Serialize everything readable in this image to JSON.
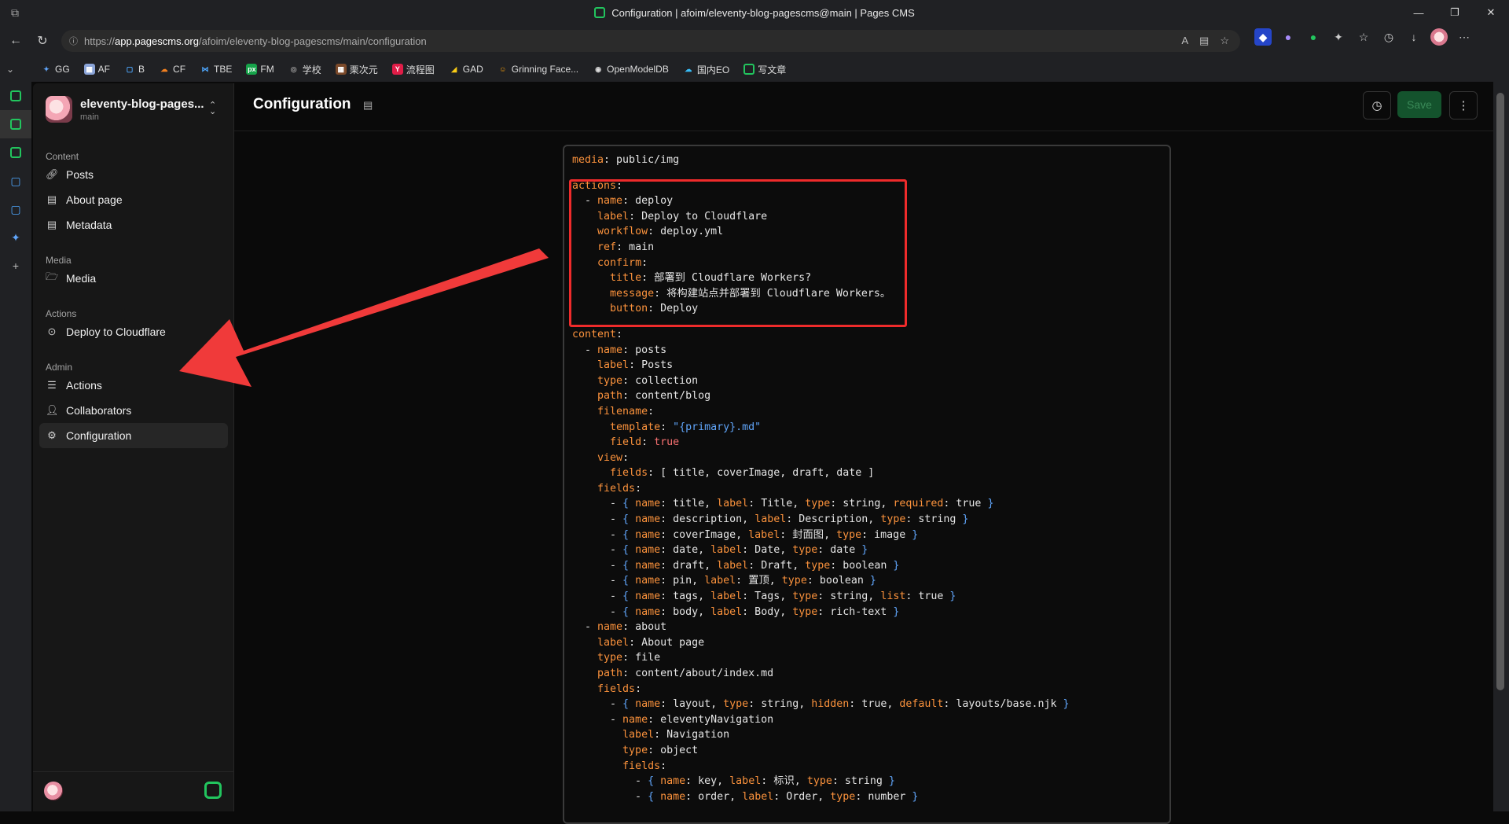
{
  "browser": {
    "window_title": "Configuration | afoim/eleventy-blog-pagescms@main | Pages CMS",
    "url_scheme": "https://",
    "url_host": "app.pagescms.org",
    "url_path": "/afoim/eleventy-blog-pagescms/main/configuration",
    "bookmarks": [
      "GG",
      "AF",
      "B",
      "CF",
      "TBE",
      "FM",
      "学校",
      "栗次元",
      "流程图",
      "GAD",
      "Grinning Face...",
      "OpenModelDB",
      "国内EO",
      "写文章"
    ]
  },
  "sidebar": {
    "repo_name": "eleventy-blog-pages...",
    "branch": "main",
    "sections": {
      "content": "Content",
      "media": "Media",
      "actions": "Actions",
      "admin": "Admin"
    },
    "items": {
      "posts": "Posts",
      "about": "About page",
      "metadata": "Metadata",
      "media": "Media",
      "deploy": "Deploy to Cloudflare",
      "actions": "Actions",
      "collaborators": "Collaborators",
      "configuration": "Configuration"
    }
  },
  "header": {
    "title": "Configuration",
    "save_label": "Save"
  },
  "editor": {
    "lines": [
      [
        [
          "k",
          "media"
        ],
        [
          "s",
          ": public/img"
        ]
      ],
      [
        [
          "k",
          "actions"
        ],
        [
          "s",
          ":"
        ]
      ],
      [
        [
          "s",
          "  - "
        ],
        [
          "k",
          "name"
        ],
        [
          "s",
          ": deploy"
        ]
      ],
      [
        [
          "s",
          "    "
        ],
        [
          "k",
          "label"
        ],
        [
          "s",
          ": Deploy to Cloudflare"
        ]
      ],
      [
        [
          "s",
          "    "
        ],
        [
          "k",
          "workflow"
        ],
        [
          "s",
          ": deploy.yml"
        ]
      ],
      [
        [
          "s",
          "    "
        ],
        [
          "k",
          "ref"
        ],
        [
          "s",
          ": main"
        ]
      ],
      [
        [
          "s",
          "    "
        ],
        [
          "k",
          "confirm"
        ],
        [
          "s",
          ":"
        ]
      ],
      [
        [
          "s",
          "      "
        ],
        [
          "k",
          "title"
        ],
        [
          "s",
          ": 部署到 Cloudflare Workers?"
        ]
      ],
      [
        [
          "s",
          "      "
        ],
        [
          "k",
          "message"
        ],
        [
          "s",
          ": 将构建站点并部署到 Cloudflare Workers。"
        ]
      ],
      [
        [
          "s",
          "      "
        ],
        [
          "k",
          "button"
        ],
        [
          "s",
          ": Deploy"
        ]
      ],
      [
        [
          "k",
          "content"
        ],
        [
          "s",
          ":"
        ]
      ],
      [
        [
          "s",
          "  - "
        ],
        [
          "k",
          "name"
        ],
        [
          "s",
          ": posts"
        ]
      ],
      [
        [
          "s",
          "    "
        ],
        [
          "k",
          "label"
        ],
        [
          "s",
          ": Posts"
        ]
      ],
      [
        [
          "s",
          "    "
        ],
        [
          "k",
          "type"
        ],
        [
          "s",
          ": collection"
        ]
      ],
      [
        [
          "s",
          "    "
        ],
        [
          "k",
          "path"
        ],
        [
          "s",
          ": content/blog"
        ]
      ],
      [
        [
          "s",
          "    "
        ],
        [
          "k",
          "filename"
        ],
        [
          "s",
          ":"
        ]
      ],
      [
        [
          "s",
          "      "
        ],
        [
          "k",
          "template"
        ],
        [
          "s",
          ": "
        ],
        [
          "b",
          "\"{primary}.md\""
        ]
      ],
      [
        [
          "s",
          "      "
        ],
        [
          "k",
          "field"
        ],
        [
          "s",
          ": "
        ],
        [
          "t",
          "true"
        ]
      ],
      [
        [
          "s",
          "    "
        ],
        [
          "k",
          "view"
        ],
        [
          "s",
          ":"
        ]
      ],
      [
        [
          "s",
          "      "
        ],
        [
          "k",
          "fields"
        ],
        [
          "s",
          ": [ title, coverImage, draft, date ]"
        ]
      ],
      [
        [
          "s",
          "    "
        ],
        [
          "k",
          "fields"
        ],
        [
          "s",
          ":"
        ]
      ],
      [
        [
          "s",
          "      - "
        ],
        [
          "b",
          "{ "
        ],
        [
          "k",
          "name"
        ],
        [
          "s",
          ": title, "
        ],
        [
          "k",
          "label"
        ],
        [
          "s",
          ": Title, "
        ],
        [
          "k",
          "type"
        ],
        [
          "s",
          ": string, "
        ],
        [
          "k",
          "required"
        ],
        [
          "s",
          ": true "
        ],
        [
          "b",
          "}"
        ]
      ],
      [
        [
          "s",
          "      - "
        ],
        [
          "b",
          "{ "
        ],
        [
          "k",
          "name"
        ],
        [
          "s",
          ": description, "
        ],
        [
          "k",
          "label"
        ],
        [
          "s",
          ": Description, "
        ],
        [
          "k",
          "type"
        ],
        [
          "s",
          ": string "
        ],
        [
          "b",
          "}"
        ]
      ],
      [
        [
          "s",
          "      - "
        ],
        [
          "b",
          "{ "
        ],
        [
          "k",
          "name"
        ],
        [
          "s",
          ": coverImage, "
        ],
        [
          "k",
          "label"
        ],
        [
          "s",
          ": 封面图, "
        ],
        [
          "k",
          "type"
        ],
        [
          "s",
          ": image "
        ],
        [
          "b",
          "}"
        ]
      ],
      [
        [
          "s",
          "      - "
        ],
        [
          "b",
          "{ "
        ],
        [
          "k",
          "name"
        ],
        [
          "s",
          ": date, "
        ],
        [
          "k",
          "label"
        ],
        [
          "s",
          ": Date, "
        ],
        [
          "k",
          "type"
        ],
        [
          "s",
          ": date "
        ],
        [
          "b",
          "}"
        ]
      ],
      [
        [
          "s",
          "      - "
        ],
        [
          "b",
          "{ "
        ],
        [
          "k",
          "name"
        ],
        [
          "s",
          ": draft, "
        ],
        [
          "k",
          "label"
        ],
        [
          "s",
          ": Draft, "
        ],
        [
          "k",
          "type"
        ],
        [
          "s",
          ": boolean "
        ],
        [
          "b",
          "}"
        ]
      ],
      [
        [
          "s",
          "      - "
        ],
        [
          "b",
          "{ "
        ],
        [
          "k",
          "name"
        ],
        [
          "s",
          ": pin, "
        ],
        [
          "k",
          "label"
        ],
        [
          "s",
          ": 置顶, "
        ],
        [
          "k",
          "type"
        ],
        [
          "s",
          ": boolean "
        ],
        [
          "b",
          "}"
        ]
      ],
      [
        [
          "s",
          "      - "
        ],
        [
          "b",
          "{ "
        ],
        [
          "k",
          "name"
        ],
        [
          "s",
          ": tags, "
        ],
        [
          "k",
          "label"
        ],
        [
          "s",
          ": Tags, "
        ],
        [
          "k",
          "type"
        ],
        [
          "s",
          ": string, "
        ],
        [
          "k",
          "list"
        ],
        [
          "s",
          ": true "
        ],
        [
          "b",
          "}"
        ]
      ],
      [
        [
          "s",
          "      - "
        ],
        [
          "b",
          "{ "
        ],
        [
          "k",
          "name"
        ],
        [
          "s",
          ": body, "
        ],
        [
          "k",
          "label"
        ],
        [
          "s",
          ": Body, "
        ],
        [
          "k",
          "type"
        ],
        [
          "s",
          ": rich-text "
        ],
        [
          "b",
          "}"
        ]
      ],
      [
        [
          "s",
          "  - "
        ],
        [
          "k",
          "name"
        ],
        [
          "s",
          ": about"
        ]
      ],
      [
        [
          "s",
          "    "
        ],
        [
          "k",
          "label"
        ],
        [
          "s",
          ": About page"
        ]
      ],
      [
        [
          "s",
          "    "
        ],
        [
          "k",
          "type"
        ],
        [
          "s",
          ": file"
        ]
      ],
      [
        [
          "s",
          "    "
        ],
        [
          "k",
          "path"
        ],
        [
          "s",
          ": content/about/index.md"
        ]
      ],
      [
        [
          "s",
          "    "
        ],
        [
          "k",
          "fields"
        ],
        [
          "s",
          ":"
        ]
      ],
      [
        [
          "s",
          "      - "
        ],
        [
          "b",
          "{ "
        ],
        [
          "k",
          "name"
        ],
        [
          "s",
          ": layout, "
        ],
        [
          "k",
          "type"
        ],
        [
          "s",
          ": string, "
        ],
        [
          "k",
          "hidden"
        ],
        [
          "s",
          ": true, "
        ],
        [
          "k",
          "default"
        ],
        [
          "s",
          ": layouts/base.njk "
        ],
        [
          "b",
          "}"
        ]
      ],
      [
        [
          "s",
          "      - "
        ],
        [
          "k",
          "name"
        ],
        [
          "s",
          ": eleventyNavigation"
        ]
      ],
      [
        [
          "s",
          "        "
        ],
        [
          "k",
          "label"
        ],
        [
          "s",
          ": Navigation"
        ]
      ],
      [
        [
          "s",
          "        "
        ],
        [
          "k",
          "type"
        ],
        [
          "s",
          ": object"
        ]
      ],
      [
        [
          "s",
          "        "
        ],
        [
          "k",
          "fields"
        ],
        [
          "s",
          ":"
        ]
      ],
      [
        [
          "s",
          "          - "
        ],
        [
          "b",
          "{ "
        ],
        [
          "k",
          "name"
        ],
        [
          "s",
          ": key, "
        ],
        [
          "k",
          "label"
        ],
        [
          "s",
          ": 标识, "
        ],
        [
          "k",
          "type"
        ],
        [
          "s",
          ": string "
        ],
        [
          "b",
          "}"
        ]
      ],
      [
        [
          "s",
          "          - "
        ],
        [
          "b",
          "{ "
        ],
        [
          "k",
          "name"
        ],
        [
          "s",
          ": order, "
        ],
        [
          "k",
          "label"
        ],
        [
          "s",
          ": Order, "
        ],
        [
          "k",
          "type"
        ],
        [
          "s",
          ": number "
        ],
        [
          "b",
          "}"
        ]
      ]
    ]
  },
  "colors": {
    "accent": "#22c55e",
    "key": "#fb923c",
    "brace": "#60a5fa",
    "bool": "#f87171",
    "highlight": "#ef2b2b"
  }
}
